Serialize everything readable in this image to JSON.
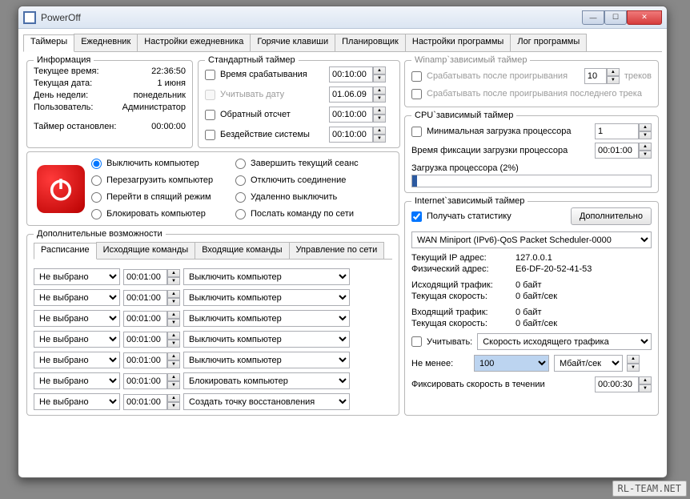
{
  "window": {
    "title": "PowerOff"
  },
  "watermark": "RL-TEAM.NET",
  "tabs": [
    "Таймеры",
    "Ежедневник",
    "Настройки ежедневника",
    "Горячие клавиши",
    "Планировщик",
    "Настройки программы",
    "Лог программы"
  ],
  "info": {
    "legend": "Информация",
    "time_label": "Текущее время:",
    "time_value": "22:36:50",
    "date_label": "Текущая дата:",
    "date_value": "1 июня",
    "dow_label": "День недели:",
    "dow_value": "понедельник",
    "user_label": "Пользователь:",
    "user_value": "Администратор",
    "stopped_label": "Таймер остановлен:",
    "stopped_value": "00:00:00"
  },
  "std": {
    "legend": "Стандартный таймер",
    "fire_label": "Время срабатывания",
    "fire_value": "00:10:00",
    "date_label": "Учитывать дату",
    "date_value": "01.06.09",
    "countdown_label": "Обратный отсчет",
    "countdown_value": "00:10:00",
    "idle_label": "Бездействие системы",
    "idle_value": "00:10:00"
  },
  "actions": {
    "shutdown": "Выключить компьютер",
    "reboot": "Перезагрузить компьютер",
    "sleep": "Перейти в спящий режим",
    "lock": "Блокировать компьютер",
    "logoff": "Завершить текущий сеанс",
    "disconnect": "Отключить соединение",
    "remote_off": "Удаленно выключить",
    "netcmd": "Послать команду по сети"
  },
  "addon": {
    "legend": "Дополнительные возможности",
    "subtabs": [
      "Расписание",
      "Исходящие команды",
      "Входящие команды",
      "Управление по сети"
    ],
    "not_selected": "Не выбрано",
    "time_default": "00:01:00",
    "act_default": "Выключить компьютер",
    "act_block": "Блокировать компьютер",
    "act_restore": "Создать точку восстановления"
  },
  "winamp": {
    "legend": "Winamp`зависимый таймер",
    "after_play": "Срабатывать после проигрывания",
    "tracks_value": "10",
    "tracks_label": "треков",
    "after_last": "Срабатывать после проигрывания последнего трека"
  },
  "cpu": {
    "legend": "CPU`зависимый таймер",
    "min_label": "Минимальная загрузка процессора",
    "min_value": "1",
    "fix_label": "Время фиксации загрузки процессора",
    "fix_value": "00:01:00",
    "load_label": "Загрузка процессора (2%)",
    "load_percent": 2
  },
  "net": {
    "legend": "Internet`зависимый таймер",
    "stats_label": "Получать статистику",
    "more_btn": "Дополнительно",
    "adapter": "WAN Miniport (IPv6)-QoS Packet Scheduler-0000",
    "ip_label": "Текущий IP адрес:",
    "ip_value": "127.0.0.1",
    "mac_label": "Физический адрес:",
    "mac_value": "E6-DF-20-52-41-53",
    "out_label": "Исходящий трафик:",
    "out_value": "0 байт",
    "out_speed_label": "Текущая скорость:",
    "out_speed_value": "0 байт/сек",
    "in_label": "Входящий трафик:",
    "in_value": "0 байт",
    "in_speed_label": "Текущая скорость:",
    "in_speed_value": "0 байт/сек",
    "consider_label": "Учитывать:",
    "consider_value": "Скорость исходящего трафика",
    "min_label": "Не менее:",
    "min_value": "100",
    "min_unit": "Мбайт/сек",
    "fix_label": "Фиксировать скорость в течении",
    "fix_value": "00:00:30"
  }
}
